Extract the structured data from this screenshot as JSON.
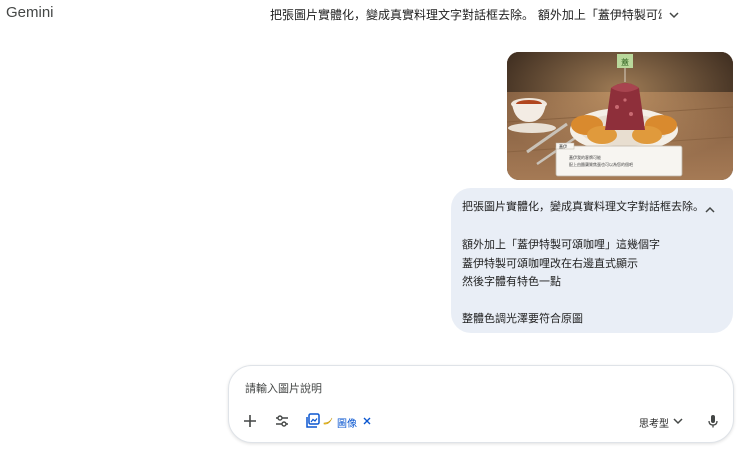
{
  "header": {
    "app_title": "Gemini",
    "conversation_title": "把張圖片實體化，變成真實料理文字對話框去除。 額外加上「蓋伊特製可頌咖哩..."
  },
  "chat": {
    "image_attachment": {
      "dialog_speaker": "蓋伊",
      "dialog_line_1": "蓋伊我的客牌可能",
      "dialog_line_2": "配上由酪蘭質焦蛋也可以為您的個吧"
    },
    "user_message_lines": [
      "把張圖片實體化，變成真實料理文字對話框去除。",
      "",
      "額外加上「蓋伊特製可頌咖哩」這幾個字",
      "蓋伊特製可頌咖哩改在右邊直式顯示",
      "然後字體有特色一點",
      "",
      "整體色調光澤要符合原圖"
    ]
  },
  "composer": {
    "placeholder": "請輸入圖片說明",
    "image_chip_label": "圖像",
    "mode_label": "思考型"
  },
  "colors": {
    "accent": "#0b57d0",
    "bubble_bg": "#e9eef6"
  }
}
